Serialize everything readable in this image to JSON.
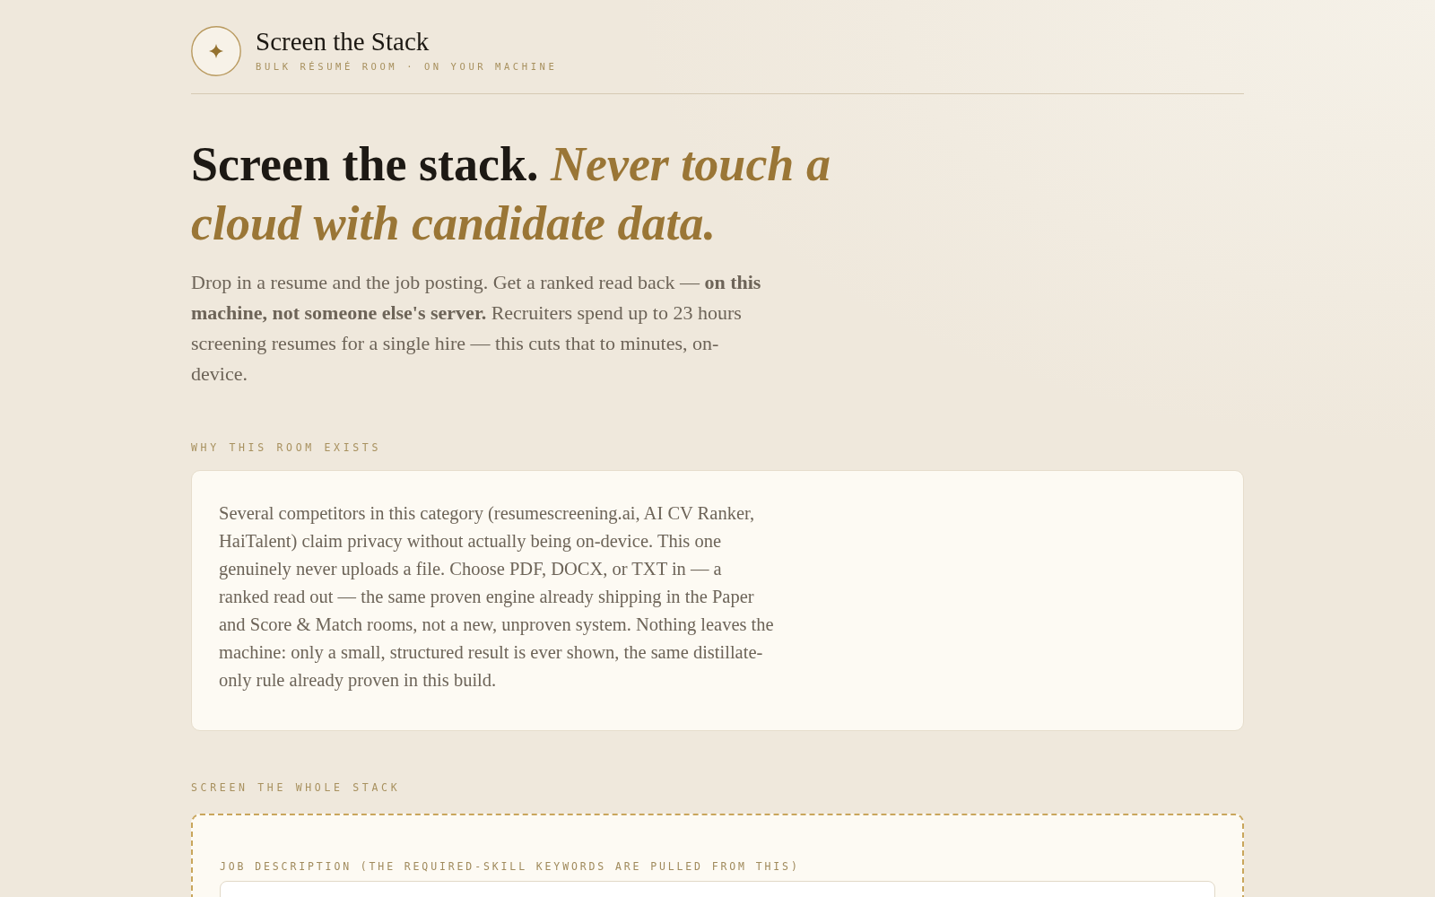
{
  "header": {
    "title": "Screen the Stack",
    "subtitle": "BULK RÉSUMÉ ROOM · ON YOUR MACHINE"
  },
  "hero": {
    "title": "Screen the stack.",
    "title_accent": "Never touch a cloud with candidate data.",
    "lead": "Drop in a resume and the job posting. Get a ranked read back — **on this machine, not someone else's server.** Recruiters spend up to 23 hours screening resumes for a single hire — this cuts that to minutes, on-device."
  },
  "sections": [
    {
      "kind": "text",
      "label": "WHY THIS ROOM EXISTS",
      "body": "Several competitors in this category (resumescreening.ai, AI CV Ranker, HaiTalent) claim privacy without actually being on-device. This one genuinely never uploads a file. Choose PDF, DOCX, or TXT in — a ranked read out — the same proven engine already shipping in the Paper and Score & Match rooms, not a new, unproven system. Nothing leaves the machine: only a small, structured result is ever shown, the same distillate-only rule already proven in this build."
    },
    {
      "kind": "form",
      "label": "SCREEN THE WHOLE STACK",
      "fields": [
        {
          "label": "JOB DESCRIPTION (THE REQUIRED-SKILL KEYWORDS ARE PULLED FROM THIS)"
        }
      ]
    }
  ]
}
